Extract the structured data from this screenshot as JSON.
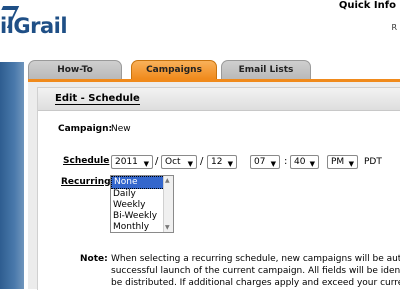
{
  "brand": {
    "logo_text": "ilGrail"
  },
  "header": {
    "quick_info": "Quick Info",
    "right_glyph": "R"
  },
  "tabs": [
    {
      "label": "How-To"
    },
    {
      "label": "Campaigns"
    },
    {
      "label": "Email Lists"
    }
  ],
  "panel": {
    "title": "Edit - Schedule"
  },
  "campaign": {
    "label": "Campaign:",
    "value": "New"
  },
  "schedule": {
    "label": "Schedule",
    "year": "2011",
    "month": "Oct",
    "day": "12",
    "hour": "07",
    "minute": "40",
    "ampm": "PM",
    "timezone": "PDT",
    "sep_slash": "/",
    "sep_colon": ":"
  },
  "recurring": {
    "label": "Recurring",
    "options": [
      "None",
      "Daily",
      "Weekly",
      "Bi-Weekly",
      "Monthly"
    ],
    "selected": "None"
  },
  "note": {
    "label": "Note:",
    "lines": [
      "When selecting a recurring schedule, new campaigns will be autc",
      "successful launch of the current campaign.  All fields will be identi",
      "be distributed.  If additional charges apply and exceed your curre"
    ]
  },
  "colors": {
    "active_tab": "#f08a1c",
    "sidebar": "#2e5d90",
    "logo": "#1f4f86"
  }
}
